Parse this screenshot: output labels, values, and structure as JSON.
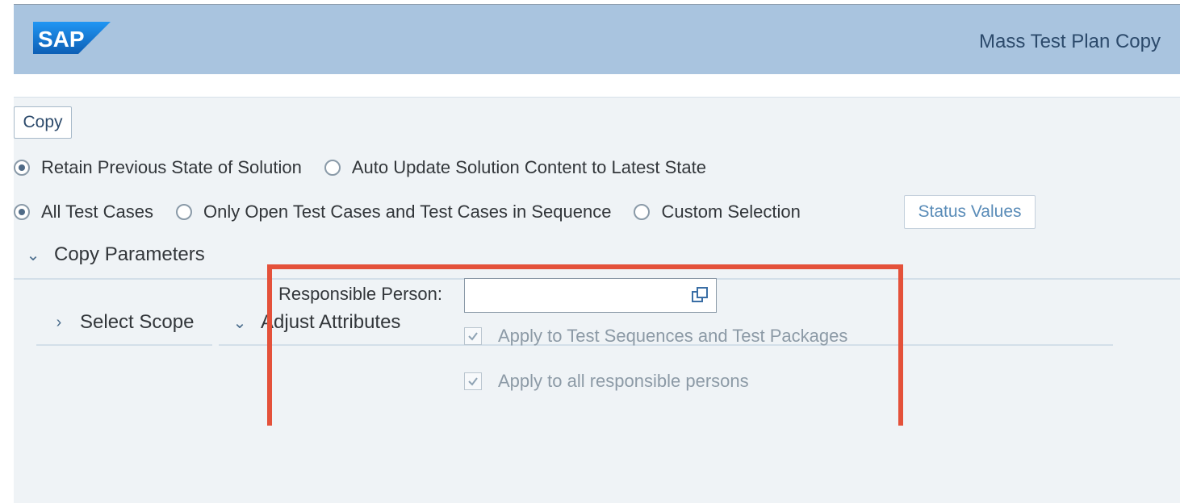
{
  "header": {
    "logo_text": "SAP",
    "title": "Mass Test Plan Copy"
  },
  "toolbar": {
    "copy_label": "Copy"
  },
  "solution_state": {
    "options": [
      {
        "label": "Retain Previous State of Solution",
        "selected": true
      },
      {
        "label": "Auto Update Solution Content to Latest State",
        "selected": false
      }
    ]
  },
  "test_case_selection": {
    "options": [
      {
        "label": "All Test Cases",
        "selected": true
      },
      {
        "label": "Only Open Test Cases and Test Cases in Sequence",
        "selected": false
      },
      {
        "label": "Custom Selection",
        "selected": false
      }
    ],
    "status_values_label": "Status Values"
  },
  "copy_parameters": {
    "label": "Copy Parameters",
    "expanded": true,
    "sections": {
      "select_scope": {
        "label": "Select Scope",
        "expanded": false
      },
      "adjust_attributes": {
        "label": "Adjust Attributes",
        "expanded": true
      }
    }
  },
  "attributes": {
    "responsible_person_label": "Responsible Person:",
    "responsible_person_value": "",
    "apply_sequences_label": "Apply to Test Sequences and Test Packages",
    "apply_sequences_checked": true,
    "apply_all_label": "Apply to all responsible persons",
    "apply_all_checked": true
  },
  "colors": {
    "header_bg": "#a9c4df",
    "content_bg": "#eff3f6",
    "highlight_border": "#e4513a",
    "logo_blue": "#1a75cf"
  }
}
